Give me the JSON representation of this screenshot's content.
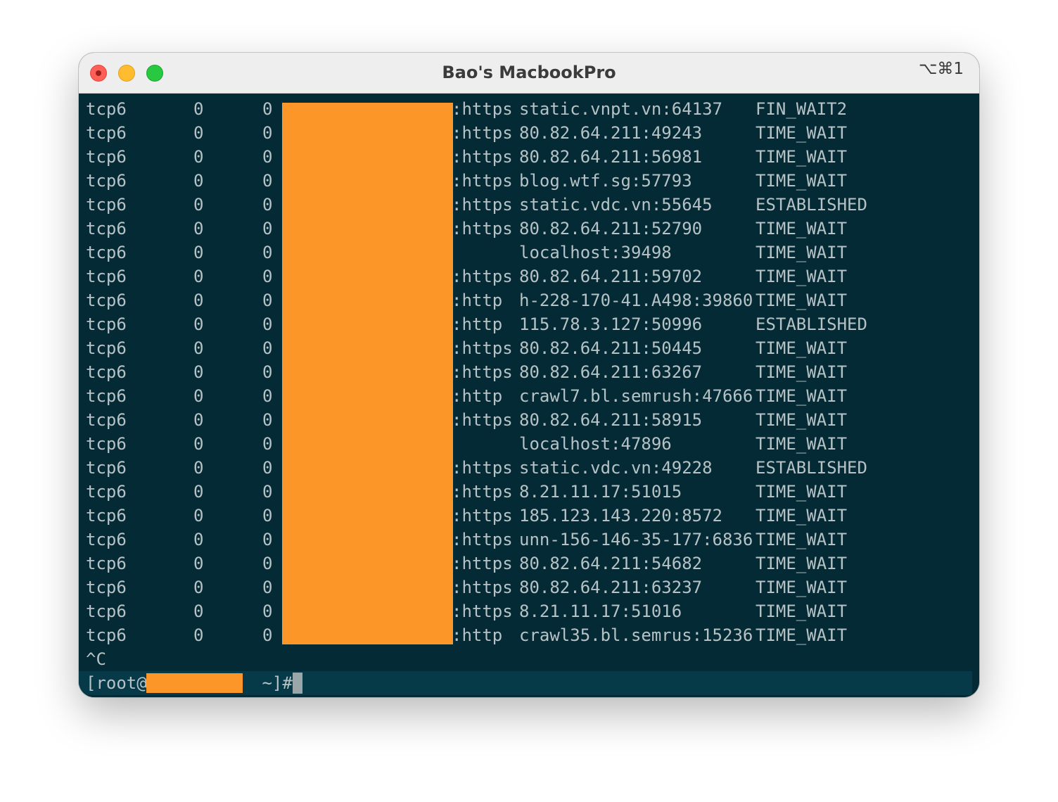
{
  "window": {
    "title": "Bao's MacbookPro",
    "shortcut": "⌥⌘1"
  },
  "terminal": {
    "rows": [
      {
        "proto": "tcp6",
        "recv": "0",
        "send": "0",
        "port": ":https",
        "foreign": "static.vnpt.vn:64137",
        "state": "FIN_WAIT2"
      },
      {
        "proto": "tcp6",
        "recv": "0",
        "send": "0",
        "port": ":https",
        "foreign": "80.82.64.211:49243",
        "state": "TIME_WAIT"
      },
      {
        "proto": "tcp6",
        "recv": "0",
        "send": "0",
        "port": ":https",
        "foreign": "80.82.64.211:56981",
        "state": "TIME_WAIT"
      },
      {
        "proto": "tcp6",
        "recv": "0",
        "send": "0",
        "port": ":https",
        "foreign": "blog.wtf.sg:57793",
        "state": "TIME_WAIT"
      },
      {
        "proto": "tcp6",
        "recv": "0",
        "send": "0",
        "port": ":https",
        "foreign": "static.vdc.vn:55645",
        "state": "ESTABLISHED"
      },
      {
        "proto": "tcp6",
        "recv": "0",
        "send": "0",
        "port": ":https",
        "foreign": "80.82.64.211:52790",
        "state": "TIME_WAIT"
      },
      {
        "proto": "tcp6",
        "recv": "0",
        "send": "0",
        "port": "",
        "foreign": "localhost:39498",
        "state": "TIME_WAIT"
      },
      {
        "proto": "tcp6",
        "recv": "0",
        "send": "0",
        "port": ":https",
        "foreign": "80.82.64.211:59702",
        "state": "TIME_WAIT"
      },
      {
        "proto": "tcp6",
        "recv": "0",
        "send": "0",
        "port": ":http",
        "foreign": "h-228-170-41.A498:39860",
        "state": "TIME_WAIT"
      },
      {
        "proto": "tcp6",
        "recv": "0",
        "send": "0",
        "port": ":http",
        "foreign": "115.78.3.127:50996",
        "state": "ESTABLISHED"
      },
      {
        "proto": "tcp6",
        "recv": "0",
        "send": "0",
        "port": ":https",
        "foreign": "80.82.64.211:50445",
        "state": "TIME_WAIT"
      },
      {
        "proto": "tcp6",
        "recv": "0",
        "send": "0",
        "port": ":https",
        "foreign": "80.82.64.211:63267",
        "state": "TIME_WAIT"
      },
      {
        "proto": "tcp6",
        "recv": "0",
        "send": "0",
        "port": ":http",
        "foreign": "crawl7.bl.semrush:47666",
        "state": "TIME_WAIT"
      },
      {
        "proto": "tcp6",
        "recv": "0",
        "send": "0",
        "port": ":https",
        "foreign": "80.82.64.211:58915",
        "state": "TIME_WAIT"
      },
      {
        "proto": "tcp6",
        "recv": "0",
        "send": "0",
        "port": "",
        "foreign": "localhost:47896",
        "state": "TIME_WAIT"
      },
      {
        "proto": "tcp6",
        "recv": "0",
        "send": "0",
        "port": ":https",
        "foreign": "static.vdc.vn:49228",
        "state": "ESTABLISHED"
      },
      {
        "proto": "tcp6",
        "recv": "0",
        "send": "0",
        "port": ":https",
        "foreign": "8.21.11.17:51015",
        "state": "TIME_WAIT"
      },
      {
        "proto": "tcp6",
        "recv": "0",
        "send": "0",
        "port": ":https",
        "foreign": "185.123.143.220:8572",
        "state": "TIME_WAIT"
      },
      {
        "proto": "tcp6",
        "recv": "0",
        "send": "0",
        "port": ":https",
        "foreign": "unn-156-146-35-177:6836",
        "state": "TIME_WAIT"
      },
      {
        "proto": "tcp6",
        "recv": "0",
        "send": "0",
        "port": ":https",
        "foreign": "80.82.64.211:54682",
        "state": "TIME_WAIT"
      },
      {
        "proto": "tcp6",
        "recv": "0",
        "send": "0",
        "port": ":https",
        "foreign": "80.82.64.211:63237",
        "state": "TIME_WAIT"
      },
      {
        "proto": "tcp6",
        "recv": "0",
        "send": "0",
        "port": ":https",
        "foreign": "8.21.11.17:51016",
        "state": "TIME_WAIT"
      },
      {
        "proto": "tcp6",
        "recv": "0",
        "send": "0",
        "port": ":http",
        "foreign": "crawl35.bl.semrus:15236",
        "state": "TIME_WAIT"
      }
    ],
    "interrupt": "^C",
    "prompt_prefix": "[root@",
    "prompt_suffix": " ~]#"
  },
  "colors": {
    "terminal_bg": "#042b35",
    "terminal_fg": "#b6c2c5",
    "redaction": "#fc9629"
  }
}
